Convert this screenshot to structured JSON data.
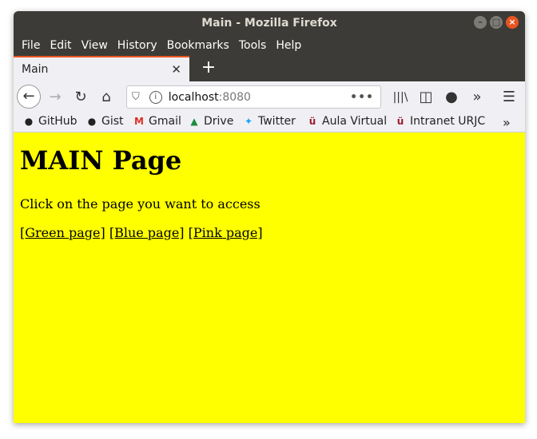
{
  "window": {
    "title": "Main - Mozilla Firefox"
  },
  "menu": [
    "File",
    "Edit",
    "View",
    "History",
    "Bookmarks",
    "Tools",
    "Help"
  ],
  "tab": {
    "label": "Main"
  },
  "url": {
    "host": "localhost",
    "port": ":8080"
  },
  "bookmarks": [
    "GitHub",
    "Gist",
    "Gmail",
    "Drive",
    "Twitter",
    "Aula Virtual",
    "Intranet URJC"
  ],
  "page": {
    "heading": "MAIN Page",
    "intro": "Click on the page you want to access",
    "links": [
      "[Green page]",
      "[Blue page]",
      "[Pink page]"
    ]
  },
  "colors": {
    "page_background": "#ffff00",
    "titlebar": "#3c3b37",
    "accent": "#e95420"
  }
}
